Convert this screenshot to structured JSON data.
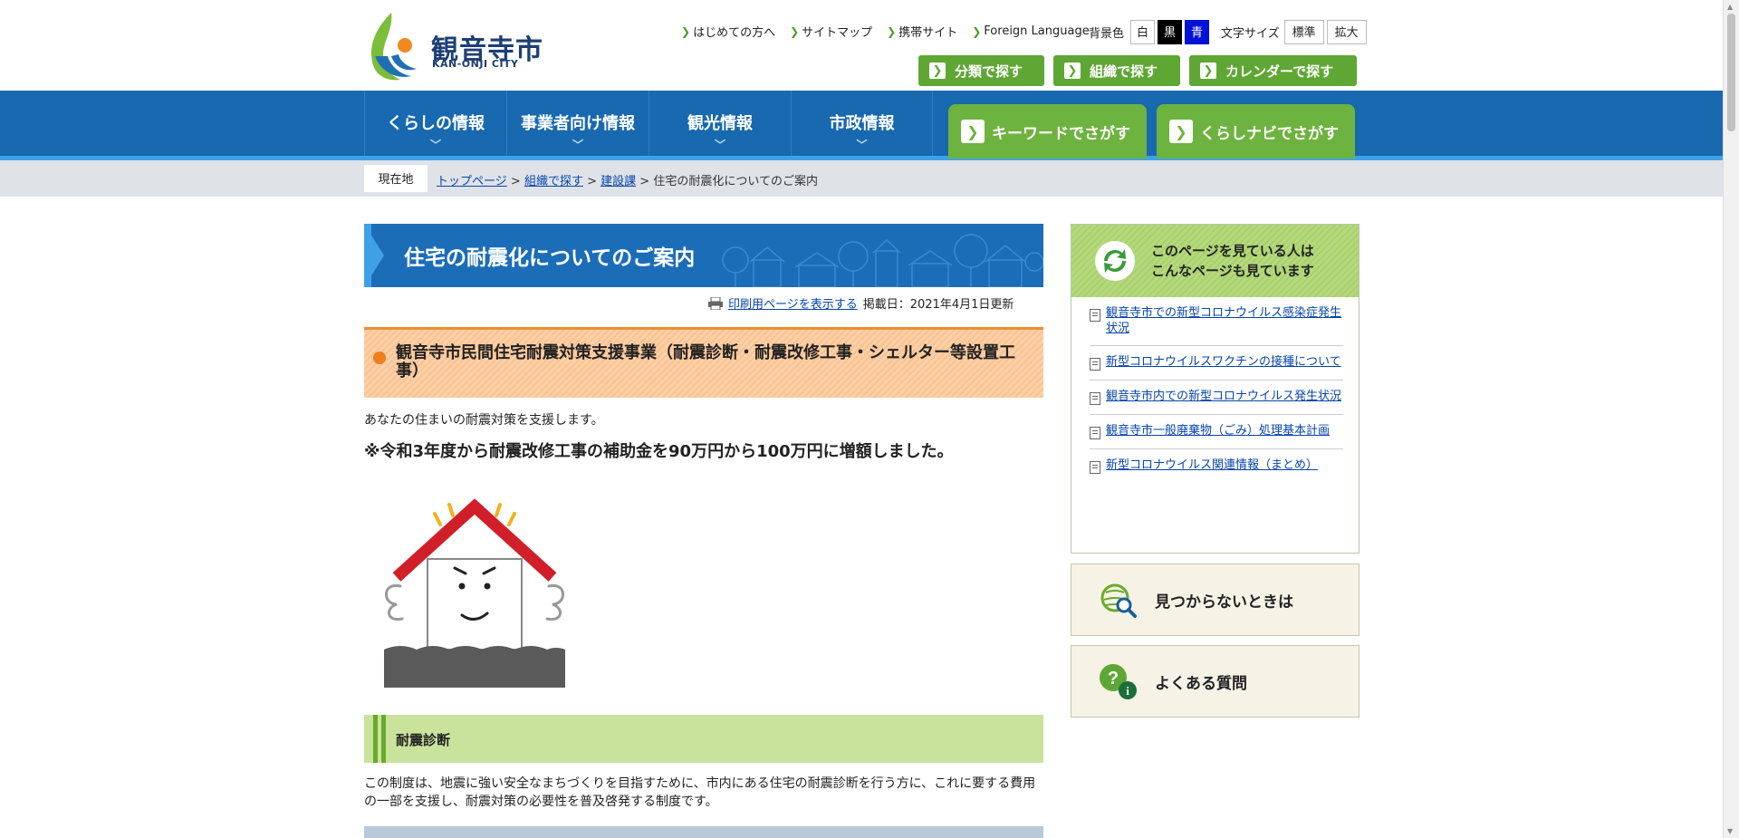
{
  "header": {
    "logo_title": "観音寺市",
    "logo_sub": "KAN-ONJI CITY",
    "util_links": [
      "はじめての方へ",
      "サイトマップ",
      "携帯サイト",
      "Foreign Language"
    ],
    "bg_label": "背景色",
    "bg_options": [
      "白",
      "黒",
      "青"
    ],
    "font_label": "文字サイズ",
    "font_options": [
      "標準",
      "拡大"
    ],
    "search_buttons": [
      "分類で探す",
      "組織で探す",
      "カレンダーで探す"
    ]
  },
  "nav": {
    "items": [
      "くらしの情報",
      "事業者向け情報",
      "観光情報",
      "市政情報"
    ],
    "search": [
      "キーワードでさがす",
      "くらしナビでさがす"
    ]
  },
  "breadcrumb": {
    "here": "現在地",
    "links": [
      "トップページ",
      "組織で探す",
      "建設課"
    ],
    "current": "住宅の耐震化についてのご案内",
    "sep": ">"
  },
  "main": {
    "title": "住宅の耐震化についてのご案内",
    "print_link": "印刷用ページを表示する",
    "date": "掲載日：2021年4月1日更新",
    "h2": "観音寺市民間住宅耐震対策支援事業（耐震診断・耐震改修工事・シェルター等設置工事）",
    "intro": "あなたの住まいの耐震対策を支援します。",
    "notice": "※令和3年度から耐震改修工事の補助金を90万円から100万円に増額しました。",
    "h3": "耐震診断",
    "body": "この制度は、地震に強い安全なまちづくりを目指すために、市内にある住宅の耐震診断を行う方に、これに要する費用の一部を支援し、耐震対策の必要性を普及啓発する制度です。"
  },
  "sidebar": {
    "title": "このページを見ている人は\nこんなページも見ています",
    "title_l1": "このページを見ている人は",
    "title_l2": "こんなページも見ています",
    "links": [
      "観音寺市での新型コロナウイルス感染症発生状況",
      "新型コロナウイルスワクチンの接種について",
      "観音寺市内での新型コロナウイルス発生状況",
      "観音寺市一般廃棄物（ごみ）処理基本計画",
      "新型コロナウイルス関連情報（まとめ）"
    ],
    "cards": [
      "見つからないときは",
      "よくある質問"
    ]
  },
  "colors": {
    "nav_blue": "#1869b0",
    "green": "#5fa734",
    "orange": "#f28c2e"
  }
}
